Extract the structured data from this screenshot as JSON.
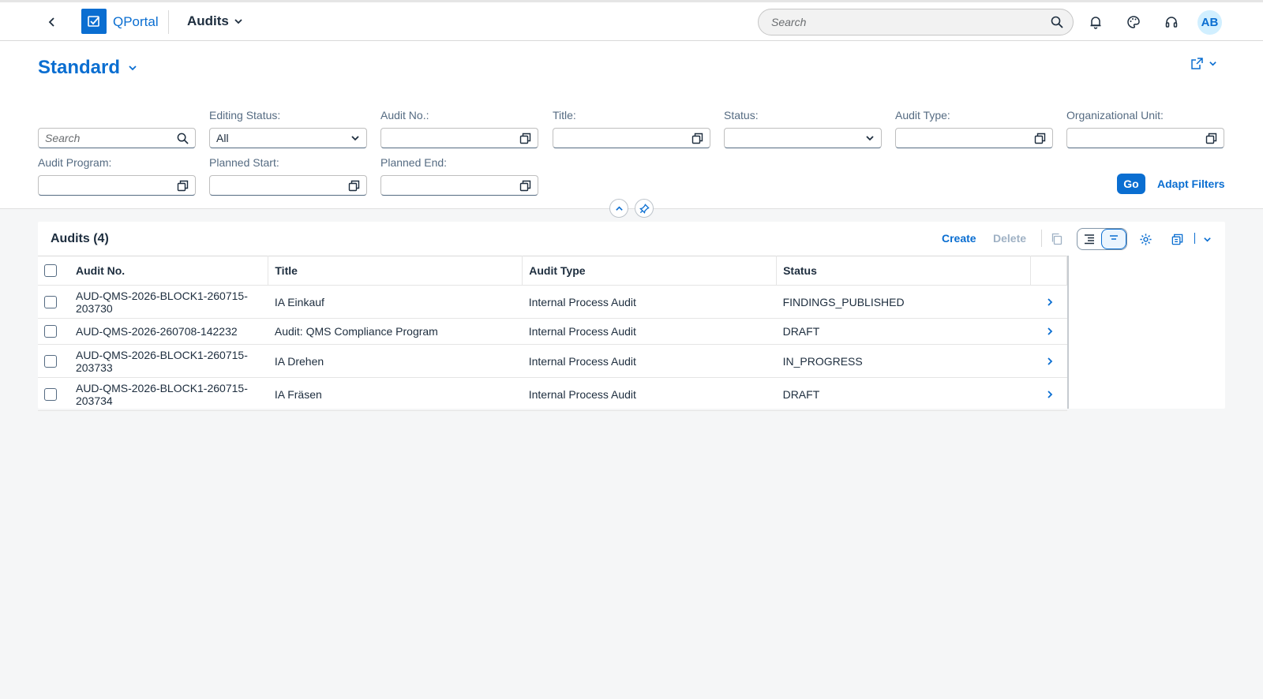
{
  "shell": {
    "brand": "QPortal",
    "app_title": "Audits",
    "search_placeholder": "Search",
    "avatar_initials": "AB"
  },
  "header": {
    "variant": "Standard"
  },
  "filters": {
    "search_placeholder": "Search",
    "editing_status_label": "Editing Status:",
    "editing_status_value": "All",
    "audit_no_label": "Audit No.:",
    "title_label": "Title:",
    "status_label": "Status:",
    "audit_type_label": "Audit Type:",
    "org_unit_label": "Organizational Unit:",
    "audit_program_label": "Audit Program:",
    "planned_start_label": "Planned Start:",
    "planned_end_label": "Planned End:",
    "go_label": "Go",
    "adapt_label": "Adapt Filters"
  },
  "table": {
    "title": "Audits (4)",
    "create_label": "Create",
    "delete_label": "Delete",
    "columns": [
      "Audit No.",
      "Title",
      "Audit Type",
      "Status"
    ],
    "rows": [
      {
        "audit_no": "AUD-QMS-2026-BLOCK1-260715-203730",
        "title": "IA Einkauf",
        "type": "Internal Process Audit",
        "status": "FINDINGS_PUBLISHED"
      },
      {
        "audit_no": "AUD-QMS-2026-260708-142232",
        "title": "Audit: QMS Compliance Program",
        "type": "Internal Process Audit",
        "status": "DRAFT"
      },
      {
        "audit_no": "AUD-QMS-2026-BLOCK1-260715-203733",
        "title": "IA Drehen",
        "type": "Internal Process Audit",
        "status": "IN_PROGRESS"
      },
      {
        "audit_no": "AUD-QMS-2026-BLOCK1-260715-203734",
        "title": "IA Fräsen",
        "type": "Internal Process Audit",
        "status": "DRAFT"
      }
    ]
  },
  "colors": {
    "brand": "#0a6ed1"
  }
}
